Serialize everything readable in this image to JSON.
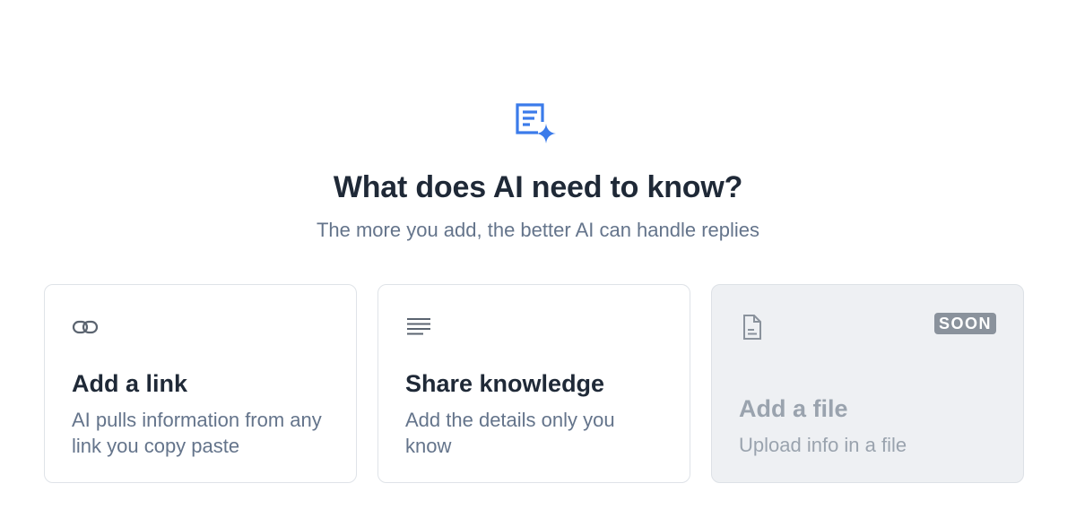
{
  "header": {
    "icon": "document-sparkle-icon",
    "title": "What does AI need to know?",
    "subtitle": "The more you add, the better AI can handle replies"
  },
  "cards": [
    {
      "icon": "link-icon",
      "title": "Add a link",
      "description": "AI pulls information from any link you copy paste",
      "enabled": true
    },
    {
      "icon": "text-lines-icon",
      "title": "Share knowledge",
      "description": "Add the details only you know",
      "enabled": true
    },
    {
      "icon": "file-icon",
      "title": "Add a file",
      "description": "Upload info in a file",
      "badge": "SOON",
      "enabled": false
    }
  ],
  "colors": {
    "accent": "#3b7bea",
    "title": "#1f2937",
    "muted": "#64748b",
    "disabled_text": "#9aa3ae",
    "disabled_bg": "#eef0f3",
    "badge_bg": "#8a929c"
  }
}
